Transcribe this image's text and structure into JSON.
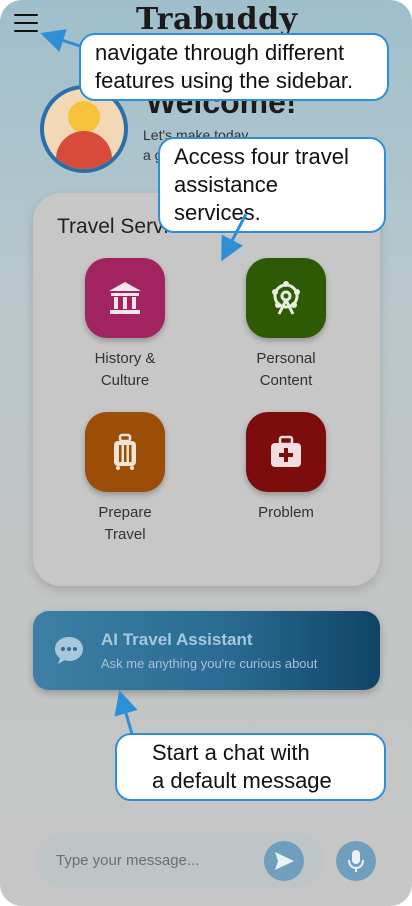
{
  "header": {
    "title": "Trabuddy",
    "menu_icon": "hamburger-menu-icon"
  },
  "welcome": {
    "title": "Welcome!",
    "subtitle_line1": "Let's make today",
    "subtitle_line2": "a g"
  },
  "services": {
    "title": "Travel Services",
    "items": [
      {
        "label_line1": "History &",
        "label_line2": "Culture",
        "icon": "museum-icon",
        "color": "#a1235f"
      },
      {
        "label_line1": "Personal",
        "label_line2": "Content",
        "icon": "ferris-wheel-icon",
        "color": "#2e5a06"
      },
      {
        "label_line1": "Prepare",
        "label_line2": "Travel",
        "icon": "luggage-icon",
        "color": "#9c4d08"
      },
      {
        "label_line1": "Problem",
        "label_line2": "",
        "icon": "first-aid-kit-icon",
        "color": "#7d0c0c"
      }
    ]
  },
  "assistant": {
    "title": "AI Travel Assistant",
    "subtitle": "Ask me anything you're curious about",
    "icon": "chat-bubble-icon"
  },
  "input": {
    "placeholder": "Type your message...",
    "value": "",
    "send_icon": "send-icon",
    "mic_icon": "microphone-icon"
  },
  "callouts": {
    "sidebar_line1": "navigate through different",
    "sidebar_line2": "features using the sidebar.",
    "services_line1": "Access four travel",
    "services_line2": "assistance services.",
    "chat_line1": "Start a chat with",
    "chat_line2": "a default message"
  },
  "colors": {
    "accent": "#2f8fd6",
    "assistant_start": "#3e7fa6",
    "assistant_end": "#0f4466"
  }
}
